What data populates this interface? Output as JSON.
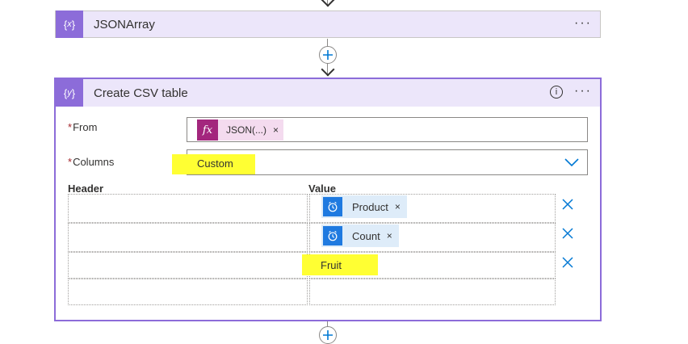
{
  "json_array_card": {
    "icon": "variable-braces-icon",
    "title": "JSONArray",
    "more_label": "···"
  },
  "csv_card": {
    "icon": "table-braces-icon",
    "title": "Create CSV table",
    "info_label": "i",
    "more_label": "···",
    "from": {
      "required_marker": "*",
      "label": "From",
      "token": {
        "icon_label": "fx",
        "label": "JSON(...)",
        "remove": "×"
      }
    },
    "columns": {
      "required_marker": "*",
      "label": "Columns",
      "value": "Custom"
    },
    "table": {
      "header_col": "Header",
      "value_col": "Value",
      "rows": [
        {
          "header": "",
          "value_token": {
            "icon": "clock-icon",
            "label": "Product",
            "remove": "×"
          }
        },
        {
          "header": "",
          "value_token": {
            "icon": "clock-icon",
            "label": "Count",
            "remove": "×"
          }
        },
        {
          "header": "",
          "value_text": "Fruit"
        },
        {
          "header": "",
          "value_text": ""
        }
      ]
    }
  },
  "colors": {
    "card_header_bg": "#ece6fa",
    "card_icon_bg": "#8c6cd9",
    "fx_token_bg": "#a3267d",
    "dynamic_token_bg": "#1f7ae0",
    "highlight": "#ffff33",
    "accent_blue": "#0078d4"
  }
}
